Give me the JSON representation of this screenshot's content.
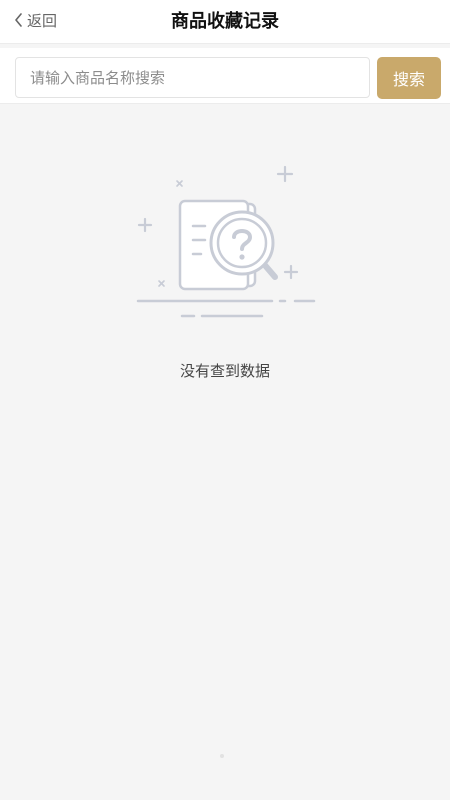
{
  "header": {
    "back_label": "返回",
    "title": "商品收藏记录"
  },
  "search": {
    "placeholder": "请输入商品名称搜索",
    "value": "",
    "button_label": "搜索"
  },
  "empty_state": {
    "message": "没有查到数据",
    "icon": "document-search-icon"
  },
  "colors": {
    "accent": "#c9a96b",
    "illustration": "#c8ccd6",
    "background": "#f5f5f5"
  }
}
